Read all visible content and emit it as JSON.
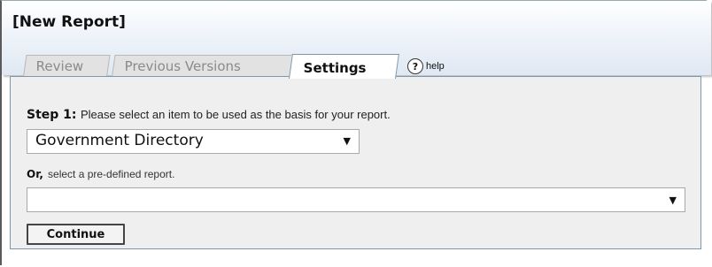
{
  "header": {
    "title": "[New Report]"
  },
  "tabs": [
    {
      "label": "Review",
      "active": false
    },
    {
      "label": "Previous Versions",
      "active": false
    },
    {
      "label": "Settings",
      "active": true
    }
  ],
  "help": {
    "icon": "help-icon",
    "icon_glyph": "?",
    "label": "help"
  },
  "form": {
    "step1_label": "Step 1:",
    "step1_text": "Please select an item to be used as the basis for your report.",
    "item_select": {
      "selected": "Government Directory"
    },
    "or_label": "Or,",
    "or_text": "select a pre-defined report.",
    "report_select": {
      "selected": ""
    },
    "continue_label": "Continue"
  },
  "colors": {
    "header_gradient_bottom": "#dfe8f3",
    "panel_background": "#efefef",
    "panel_border": "#7f97ad"
  }
}
